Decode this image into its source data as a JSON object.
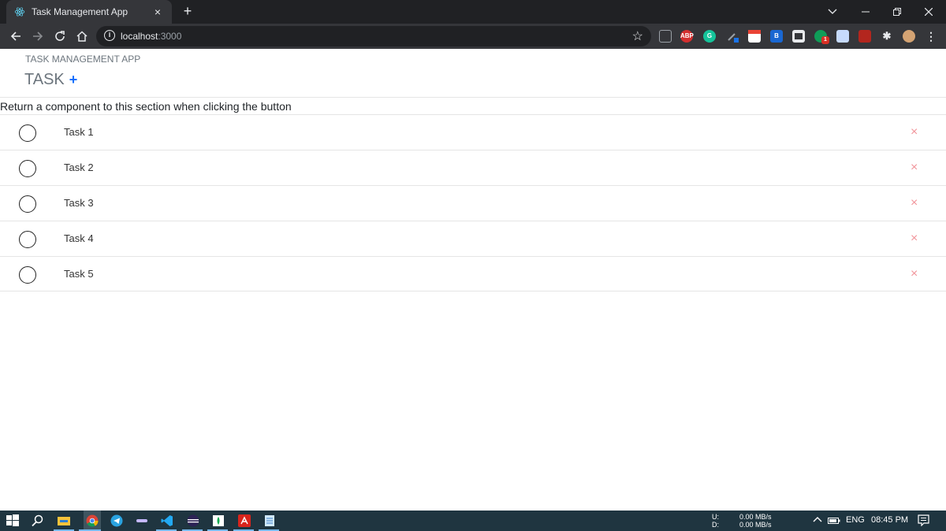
{
  "browser": {
    "tab_title": "Task Management App",
    "tab_close": "×",
    "new_tab": "+",
    "url_host": "localhost",
    "url_port": ":3000",
    "extensions": [
      "ABP",
      "G",
      "B",
      "1"
    ]
  },
  "app": {
    "title": "TASK MANAGEMENT APP",
    "heading": "TASK",
    "add_symbol": "+",
    "section_text": "Return a component to this section when clicking the button",
    "tasks": [
      {
        "label": "Task 1"
      },
      {
        "label": "Task 2"
      },
      {
        "label": "Task 3"
      },
      {
        "label": "Task 4"
      },
      {
        "label": "Task 5"
      }
    ],
    "delete_symbol": "×"
  },
  "taskbar": {
    "upload_label": "U:",
    "download_label": "D:",
    "upload_speed": "0.00 MB/s",
    "download_speed": "0.00 MB/s",
    "language": "ENG",
    "time": "08:45 PM"
  },
  "colors": {
    "accent": "#0d6efd",
    "delete": "#f1959b"
  }
}
